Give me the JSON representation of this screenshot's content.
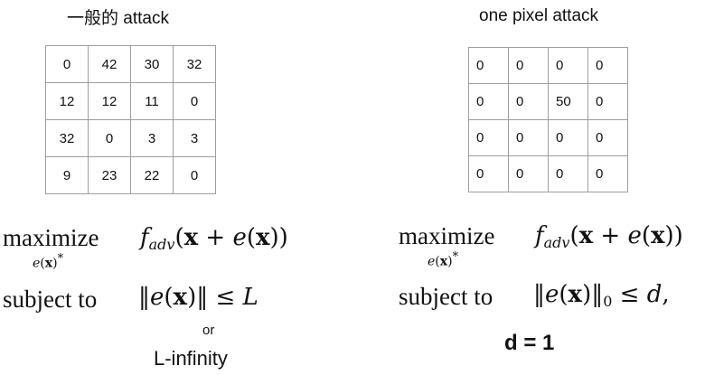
{
  "left": {
    "title": "一般的 attack",
    "grid": [
      [
        "0",
        "42",
        "30",
        "32"
      ],
      [
        "12",
        "12",
        "11",
        "0"
      ],
      [
        "32",
        "0",
        "3",
        "3"
      ],
      [
        "9",
        "23",
        "22",
        "0"
      ]
    ],
    "maximize_label": "maximize",
    "maximize_subscript": "e(x)*",
    "objective": "f_adv(x + e(x))",
    "subject_label": "subject to",
    "constraint": "‖e(x)‖ ≤ L",
    "or_label": "or",
    "norm_note": "L-infinity"
  },
  "right": {
    "title": "one pixel attack",
    "grid": [
      [
        "0",
        "0",
        "0",
        "0"
      ],
      [
        "0",
        "0",
        "50",
        "0"
      ],
      [
        "0",
        "0",
        "0",
        "0"
      ],
      [
        "0",
        "0",
        "0",
        "0"
      ]
    ],
    "maximize_label": "maximize",
    "maximize_subscript": "e(x)*",
    "objective": "f_adv(x + e(x))",
    "subject_label": "subject to",
    "constraint": "‖e(x)‖₀ ≤ d,",
    "d_note": "d = 1"
  }
}
